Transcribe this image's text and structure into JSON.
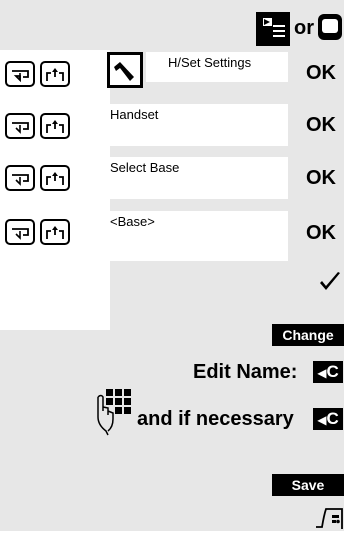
{
  "top": {
    "or_label": "or"
  },
  "rows": [
    {
      "label": "H/Set Settings",
      "ok_label": "OK",
      "has_tool_icon": true
    },
    {
      "label": "Handset",
      "ok_label": "OK",
      "has_tool_icon": false
    },
    {
      "label": "Select Base",
      "ok_label": "OK",
      "has_tool_icon": false
    },
    {
      "label": "<Base>",
      "ok_label": "OK",
      "has_tool_icon": false
    }
  ],
  "actions": {
    "change_label": "Change",
    "edit_name_label": "Edit Name:",
    "if_necessary_label": "and if necessary",
    "c_key_label": "C",
    "save_label": "Save"
  },
  "colors": {
    "grey_panel": "#e7e7e7",
    "black": "#000000",
    "white": "#ffffff"
  },
  "icons": [
    "menu-key-icon",
    "end-key-icon",
    "down-arrow-key-icon",
    "up-arrow-key-icon",
    "tool-icon",
    "checkmark-icon",
    "backspace-icon",
    "keypad-hand-icon",
    "handset-end-icon"
  ]
}
